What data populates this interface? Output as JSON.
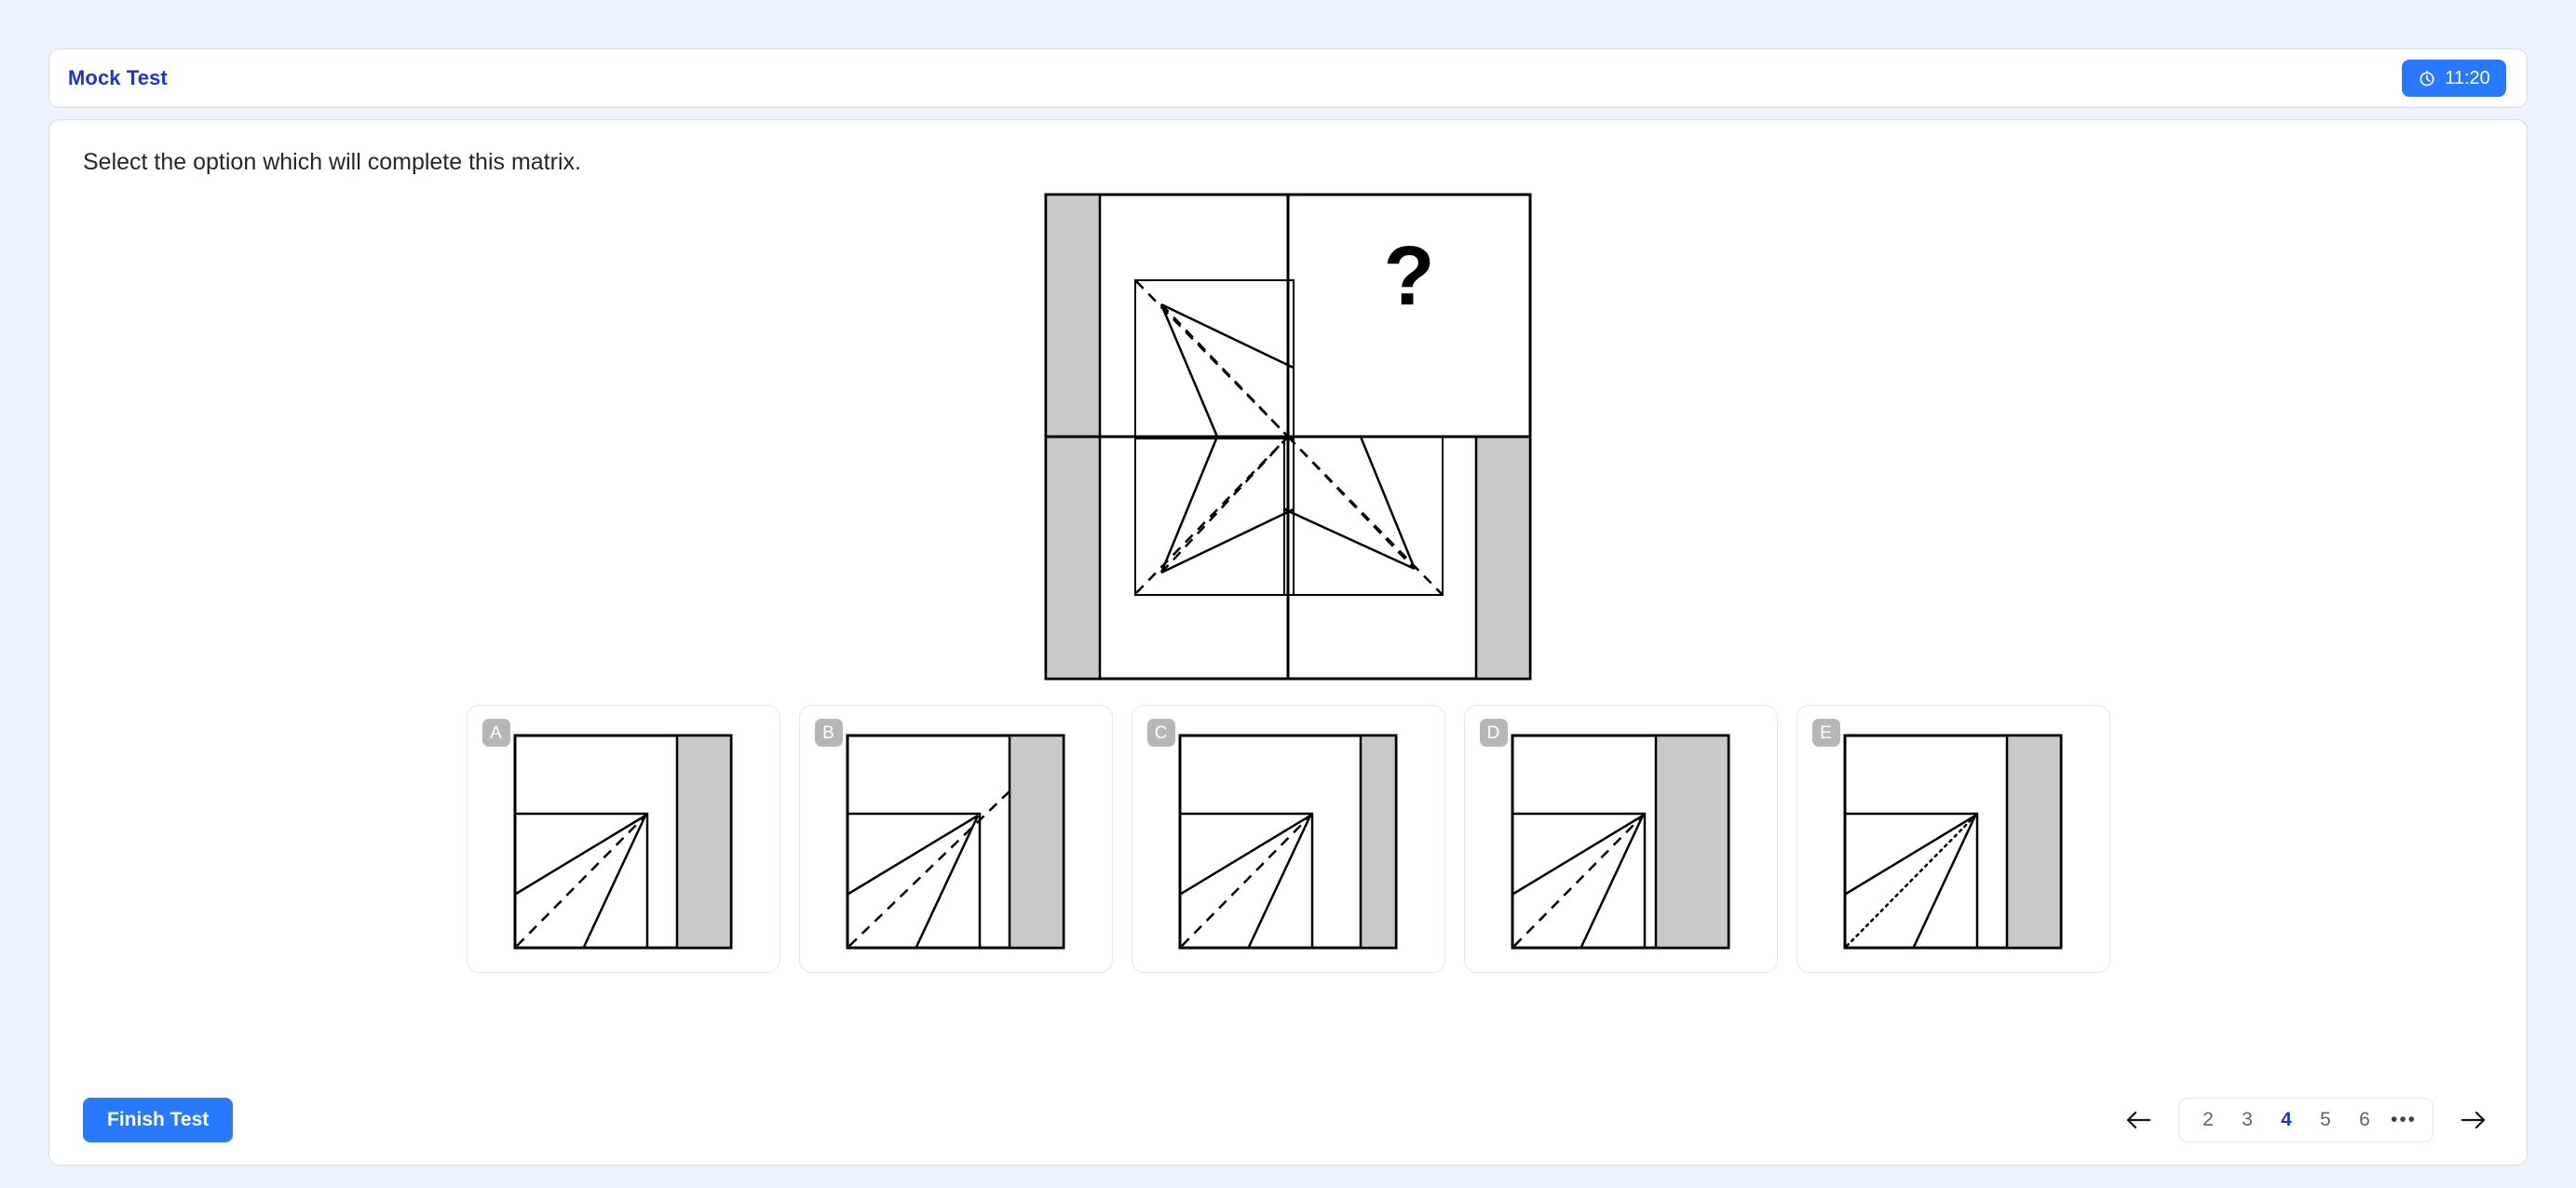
{
  "header": {
    "title": "Mock Test",
    "timer": {
      "label": "11:20",
      "icon": "timer-icon",
      "bg": "#2979ff"
    }
  },
  "question": {
    "prompt": "Select the option which will complete this matrix.",
    "missing_marker": "?"
  },
  "matrix": {
    "rows": 2,
    "cols": 2,
    "shading_color": "#c9c9c9",
    "stroke_color": "#000000",
    "cells": [
      {
        "id": "r1c1",
        "bar_side": "left",
        "inner_square": "bottom-right",
        "content": "pinwheel-quadrant",
        "dash_style": "dashed"
      },
      {
        "id": "r1c2",
        "bar_side": "none",
        "inner_square": "none",
        "content": "question-mark",
        "dash_style": "none"
      },
      {
        "id": "r2c1",
        "bar_side": "left",
        "inner_square": "top-right",
        "content": "pinwheel-quadrant",
        "dash_style": "dashed"
      },
      {
        "id": "r2c2",
        "bar_side": "right",
        "inner_square": "top-left",
        "content": "pinwheel-quadrant",
        "dash_style": "dashed"
      }
    ]
  },
  "options": [
    {
      "letter": "A",
      "bar_width": "medium",
      "bar_gap": true,
      "dash_style": "dashed",
      "dash_extends": false
    },
    {
      "letter": "B",
      "bar_width": "medium",
      "bar_gap": true,
      "dash_style": "dashed",
      "dash_extends": true
    },
    {
      "letter": "C",
      "bar_width": "narrow",
      "bar_gap": true,
      "dash_style": "dashed",
      "dash_extends": false
    },
    {
      "letter": "D",
      "bar_width": "wide",
      "bar_gap": true,
      "dash_style": "dashed",
      "dash_extends": false
    },
    {
      "letter": "E",
      "bar_width": "medium",
      "bar_gap": true,
      "dash_style": "dotted",
      "dash_extends": false
    }
  ],
  "footer": {
    "finish_label": "Finish Test",
    "prev_icon": "arrow-left-icon",
    "next_icon": "arrow-right-icon",
    "pages": [
      "2",
      "3",
      "4",
      "5",
      "6"
    ],
    "active_page": "4",
    "ellipsis": "•••",
    "accent": "#1f35c4"
  }
}
